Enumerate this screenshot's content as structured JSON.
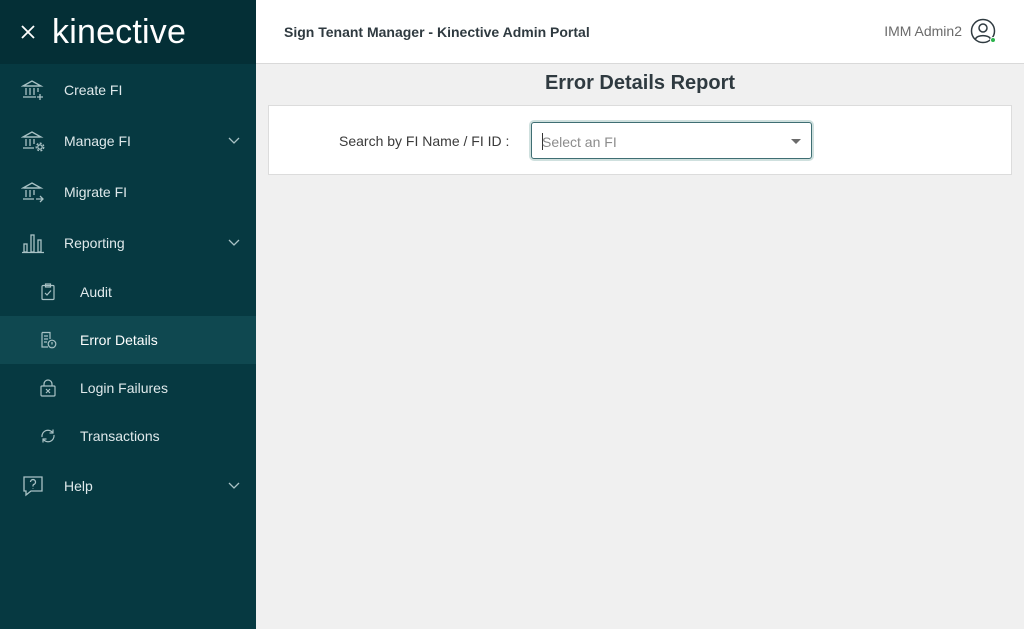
{
  "brand": {
    "logo_text": "kinective"
  },
  "sidebar": {
    "items": [
      {
        "label": "Create FI",
        "icon": "bank-add-icon"
      },
      {
        "label": "Manage FI",
        "icon": "bank-gear-icon"
      },
      {
        "label": "Migrate FI",
        "icon": "bank-arrow-icon"
      },
      {
        "label": "Reporting",
        "icon": "bar-chart-icon"
      },
      {
        "label": "Help",
        "icon": "help-chat-icon"
      }
    ],
    "reporting_subitems": [
      {
        "label": "Audit",
        "icon": "clipboard-check-icon"
      },
      {
        "label": "Error Details",
        "icon": "document-alert-icon",
        "active": true
      },
      {
        "label": "Login Failures",
        "icon": "lock-x-icon"
      },
      {
        "label": "Transactions",
        "icon": "sync-arrows-icon"
      }
    ]
  },
  "header": {
    "title": "Sign Tenant Manager - Kinective Admin Portal",
    "user_name": "IMM Admin2"
  },
  "main": {
    "heading": "Error Details Report",
    "search_label": "Search by FI Name / FI ID :",
    "select_placeholder": "Select an FI"
  },
  "colors": {
    "sidebar_bg": "#063941",
    "sidebar_active_bg": "#0f4850",
    "status_online": "#2bb24c"
  }
}
